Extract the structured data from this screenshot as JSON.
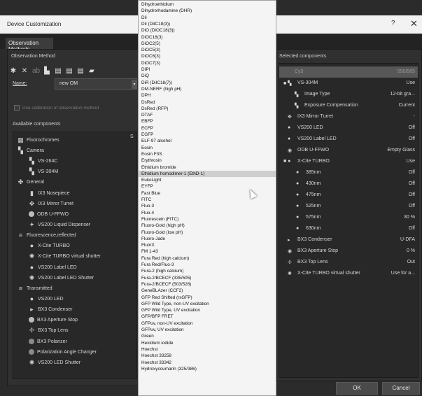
{
  "window": {
    "title": "Device Customization",
    "help": "?",
    "close": "✕"
  },
  "tabs": [
    {
      "label": "Observation Methods"
    }
  ],
  "left": {
    "observation_method_label": "Observation Method",
    "name_label": "Name:",
    "name_value": "new OM",
    "use_calibration": "Use calibration of observation method",
    "available_components_label": "Available components",
    "tree": [
      {
        "label": "Fluorochromes",
        "icon": "list-icon"
      },
      {
        "label": "Camera",
        "icon": "camera-icon"
      },
      {
        "label": "VS-264C",
        "icon": "camera-icon"
      },
      {
        "label": "VS-304M",
        "icon": "camera-icon"
      },
      {
        "label": "General",
        "icon": "general-icon"
      },
      {
        "label": "IX3 Nosepiece",
        "icon": "nosepiece-icon"
      },
      {
        "label": "IX3 Mirror Turret",
        "icon": "turret-icon"
      },
      {
        "label": "ODB U-FFWO",
        "icon": "disc-icon"
      },
      {
        "label": "VS200 Liquid Dispenser",
        "icon": "dispenser-icon"
      },
      {
        "label": "Fluorescence,reflected",
        "icon": "fluorescence-icon"
      },
      {
        "label": "X-Cite TURBO",
        "icon": "lamp-icon"
      },
      {
        "label": "X-Cite TURBO virtual shutter",
        "icon": "shutter-icon"
      },
      {
        "label": "VS200 Label LED",
        "icon": "lamp-icon"
      },
      {
        "label": "VS200 Label LED Shutter",
        "icon": "shutter-icon"
      },
      {
        "label": "Transmitted",
        "icon": "transmitted-icon"
      },
      {
        "label": "VS200 LED",
        "icon": "lamp-icon"
      },
      {
        "label": "BX3 Condenser",
        "icon": "condenser-icon"
      },
      {
        "label": "BX3 Aperture Stop",
        "icon": "aperture-icon"
      },
      {
        "label": "BX3 Top Lens",
        "icon": "lens-icon"
      },
      {
        "label": "BX3 Polarizer",
        "icon": "disc-icon"
      },
      {
        "label": "Polarization Angle Changer",
        "icon": "disc-icon"
      },
      {
        "label": "VS200 LED Shutter",
        "icon": "shutter-icon"
      }
    ]
  },
  "dropdown": {
    "items": [
      "Dihydroethidium",
      "Dihydrorhodamine (DHR)",
      "DiI",
      "DiI (DiIC18(3))",
      "DiO (DiOC18(3))",
      "DiOC16(3)",
      "DiOC2(5)",
      "DiOC5(3)",
      "DiOC6(3)",
      "DiOC7(3)",
      "DIPI",
      "DiQ",
      "DiR (DiIC18(7))",
      "DM-NERF (high pH)",
      "DPH",
      "DsRed",
      "DsRed (RFP)",
      "DTAF",
      "EBFP",
      "ECFP",
      "EGFP",
      "ELF-97 alcohol",
      "Eosin",
      "Eosin F3S",
      "Erythrosin",
      "Ethidium bromide",
      "Ethidium homodimer-1 (EthD-1)",
      "EukoLight",
      "EYFP",
      "Fast Blue",
      "FITC",
      "Fluo-3",
      "Fluo-4",
      "Fluorescein (FITC)",
      "Fluoro-Gold (high pH)",
      "Fluoro-Gold (low pH)",
      "Fluoro-Jade",
      "FluorX",
      "FM 1-43",
      "Fura Red (high calcium)",
      "Fura Red/Fluo-3",
      "Fura-2 (high calcium)",
      "Fura-2/BCECF (335/505)",
      "Fura-2/BCECF (503/528)",
      "GeneBLAzer (CCF2)",
      "GFP Red Shifted (rsGFP)",
      "GFP Wild Type, non-UV excitation",
      "GFP Wild Type, UV excitation",
      "GFP/BFP FRET",
      "GFPuv, non-UV excitation",
      "GFPuv, UV excitation",
      "Green",
      "Hexidium iodide",
      "Hoechst",
      "Hoechst 33258",
      "Hoechst 33342",
      "Hydroxycoumarin (325/386)"
    ],
    "selected_index": 26
  },
  "stubs": {
    "s_label": "S"
  },
  "right": {
    "selected_components_label": "Selected components",
    "rows": [
      {
        "label": "Cy3",
        "value": "550/565",
        "icon": "checkbox-icon",
        "highlight": true
      },
      {
        "label": "VS-304M",
        "value": "Use",
        "icon": "camera-icon"
      },
      {
        "label": "Image Type",
        "value": "12-bit gra...",
        "icon": "camera-icon"
      },
      {
        "label": "Exposure Compensation",
        "value": "Current",
        "icon": "camera-icon"
      },
      {
        "label": "IX3 Mirror Turret",
        "value": "-",
        "icon": "turret-icon"
      },
      {
        "label": "VS200 LED",
        "value": "Off",
        "icon": "lamp-icon"
      },
      {
        "label": "VS200 Label LED",
        "value": "Off",
        "icon": "lamp-icon"
      },
      {
        "label": "ODB U-FFWO",
        "value": "Empty Glass",
        "icon": "disc-icon"
      },
      {
        "label": "X-Cite TURBO",
        "value": "Use",
        "icon": "lamp-icon"
      },
      {
        "label": "385nm",
        "value": "Off",
        "icon": "lamp-icon"
      },
      {
        "label": "430nm",
        "value": "Off",
        "icon": "lamp-icon"
      },
      {
        "label": "475nm",
        "value": "Off",
        "icon": "lamp-icon"
      },
      {
        "label": "525nm",
        "value": "Off",
        "icon": "lamp-icon"
      },
      {
        "label": "575nm",
        "value": "30 %",
        "icon": "lamp-icon"
      },
      {
        "label": "630nm",
        "value": "Off",
        "icon": "lamp-icon"
      },
      {
        "label": "BX3 Condenser",
        "value": "U-DFA",
        "icon": "condenser-icon"
      },
      {
        "label": "BX3 Aperture Stop",
        "value": "0 %",
        "icon": "aperture-icon"
      },
      {
        "label": "BX3 Top Lens",
        "value": "Out",
        "icon": "lens-icon"
      },
      {
        "label": "X-Cite TURBO virtual shutter",
        "value": "Use for a...",
        "icon": "shutter-icon"
      }
    ]
  },
  "buttons": {
    "ok": "OK",
    "cancel": "Cancel"
  }
}
